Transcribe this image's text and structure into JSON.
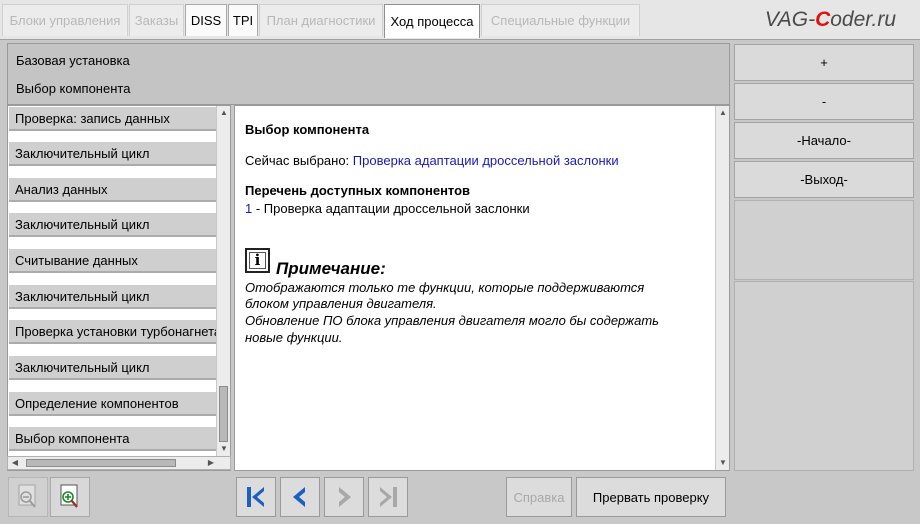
{
  "tabs": [
    {
      "label": "Блоки управления",
      "state": "disabled"
    },
    {
      "label": "Заказы",
      "state": "disabled"
    },
    {
      "label": "DISS",
      "state": "enabled"
    },
    {
      "label": "TPI",
      "state": "enabled"
    },
    {
      "label": "План диагностики",
      "state": "disabled"
    },
    {
      "label": "Ход процесса",
      "state": "active"
    },
    {
      "label": "Специальные функции",
      "state": "disabled"
    }
  ],
  "watermark": {
    "prefix": "VAG-",
    "accent": "C",
    "suffix": "oder.ru",
    "accent_color": "#e0120e"
  },
  "header": {
    "line1": "Базовая установка",
    "line2": "Выбор компонента"
  },
  "steps": [
    "Проверка: запись данных",
    "Заключительный цикл",
    "Анализ данных",
    "Заключительный цикл",
    "Считывание данных",
    "Заключительный цикл",
    "Проверка установки турбонагнетателя",
    "Заключительный цикл",
    "Определение компонентов",
    "Выбор компонента"
  ],
  "content": {
    "title": "Выбор компонента",
    "selected_label": "Сейчас выбрано: ",
    "selected_value": "Проверка адаптации дроссельной заслонки",
    "list_title": "Перечень доступных компонентов",
    "item_number": "1",
    "item_text": " - Проверка адаптации дроссельной заслонки",
    "note_icon_letter": "i",
    "note_title": "Примечание:",
    "note_lines": [
      "Отображаются только те функции, которые поддерживаются",
      "блоком управления двигателя.",
      "Обновление ПО блока управления двигателя могло бы содержать",
      "новые функции."
    ],
    "link_color": "#1a1ab8"
  },
  "right_buttons": [
    "+",
    "-",
    "-Начало-",
    "-Выход-"
  ],
  "bottom": {
    "help_label": "Справка",
    "abort_label": "Прервать проверку"
  }
}
